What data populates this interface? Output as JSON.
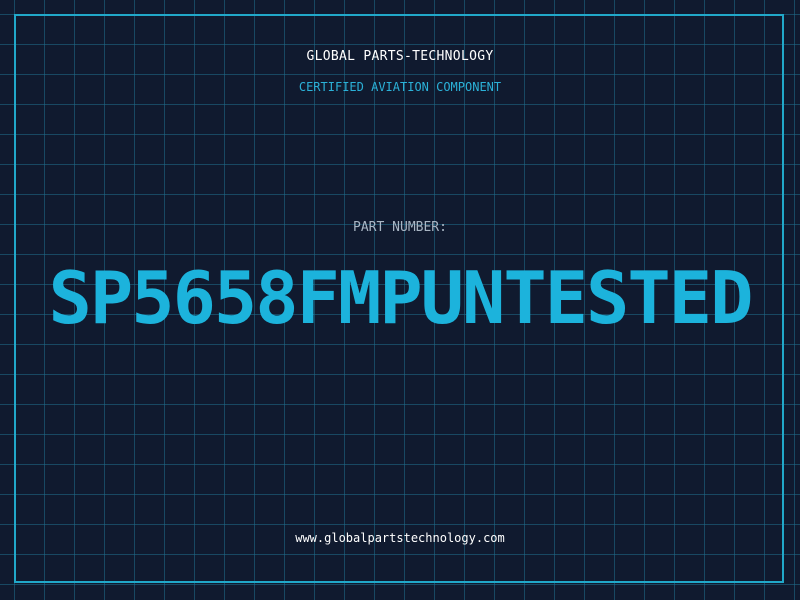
{
  "header": {
    "company": "GLOBAL PARTS-TECHNOLOGY",
    "tagline": "CERTIFIED AVIATION COMPONENT"
  },
  "part": {
    "label": "PART NUMBER:",
    "number": "SP5658FMPUNTESTED"
  },
  "footer": {
    "website": "www.globalpartstechnology.com"
  },
  "colors": {
    "background": "#101a2f",
    "grid": "#206e8c",
    "frame": "#21a8c9",
    "accent": "#1cb3dc"
  }
}
